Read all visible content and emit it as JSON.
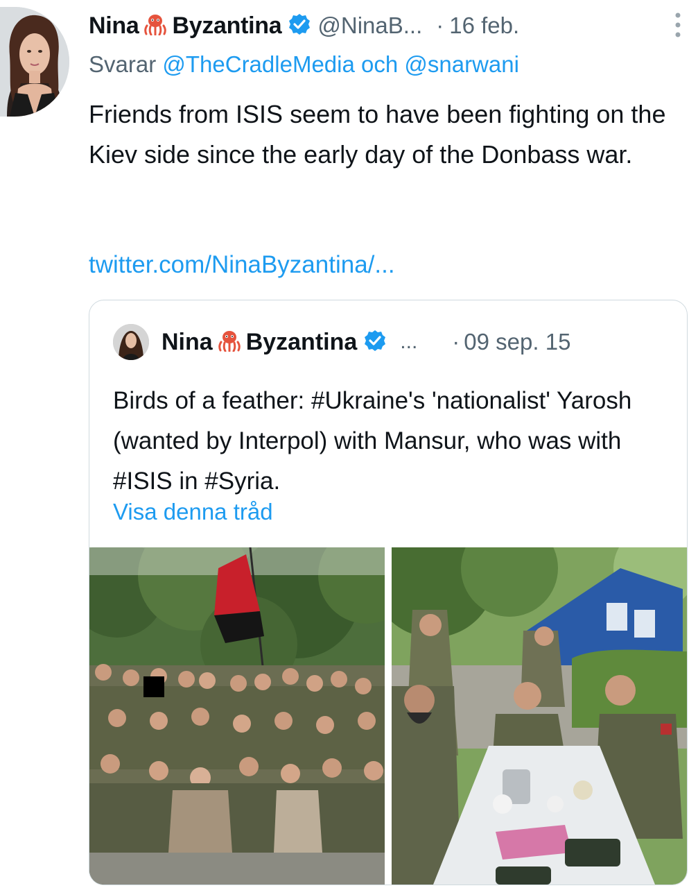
{
  "tweet": {
    "display_name_first": "Nina",
    "display_name_last": "Byzantina",
    "emoji": "octopus",
    "handle": "@NinaB...",
    "date_sep": "·",
    "date": "16 feb.",
    "reply_prefix": "Svarar",
    "reply_mention_1": "@TheCradleMedia",
    "reply_conjunction": "och",
    "reply_mention_2": "@snarwani",
    "text": "Friends from ISIS seem to have been fighting on the Kiev side since the early day of the Donbass war.",
    "link": "twitter.com/NinaByzantina/..."
  },
  "quoted_tweet": {
    "display_name_first": "Nina",
    "display_name_last": "Byzantina",
    "ellipsis": "...",
    "date_sep": "·",
    "date": "09 sep. 15",
    "text": "Birds of a feather: #Ukraine's 'nationalist' Yarosh (wanted by Interpol) with Mansur, who was with #ISIS in #Syria.",
    "show_thread": "Visa denna tråd"
  },
  "icons": {
    "verified": "verified-badge-icon",
    "more": "more-vertical-icon",
    "emoji": "octopus-icon"
  },
  "colors": {
    "link": "#1d9bf0",
    "secondary_text": "#536471",
    "primary_text": "#0f1419",
    "border": "#cfd9de",
    "flag_red": "#c8202b",
    "flag_black": "#151515"
  }
}
